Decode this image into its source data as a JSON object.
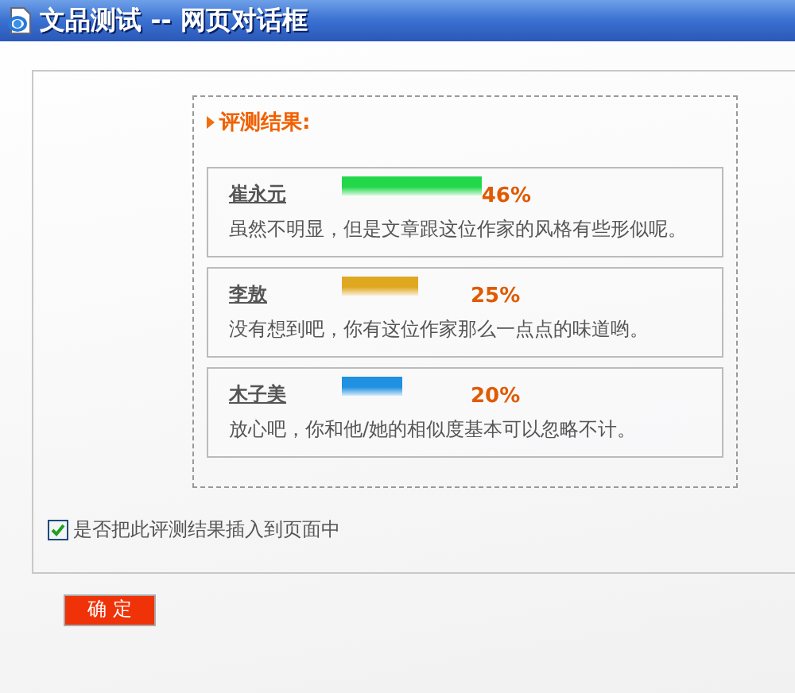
{
  "window": {
    "title": "文品测试 -- 网页对话框"
  },
  "results": {
    "heading": "评测结果:",
    "items": [
      {
        "name": "崔永元",
        "color": "#22d84a",
        "percent": "46%",
        "comment": "虽然不明显，但是文章跟这位作家的风格有些形似呢。"
      },
      {
        "name": "李敖",
        "color": "#e0a820",
        "percent": "25%",
        "comment": "没有想到吧，你有这位作家那么一点点的味道哟。"
      },
      {
        "name": "木子美",
        "color": "#2090e0",
        "percent": "20%",
        "comment": "放心吧，你和他/她的相似度基本可以忽略不计。"
      }
    ]
  },
  "insert_option": {
    "label": "是否把此评测结果插入到页面中",
    "checked": true
  },
  "buttons": [
    "确 定"
  ]
}
